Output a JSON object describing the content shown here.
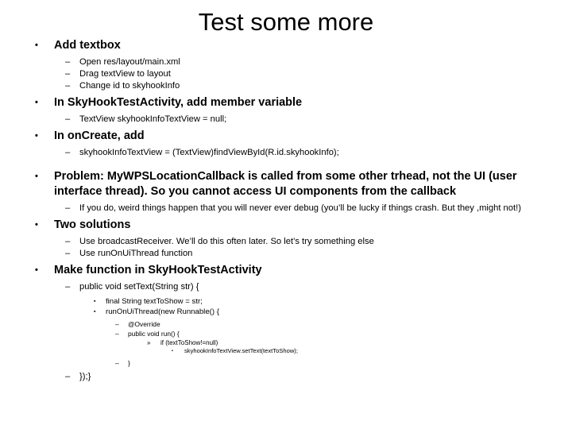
{
  "slide": {
    "title": "Test some more",
    "background_color": "#ffffff",
    "text_color": "#000000",
    "markers": {
      "level1": "•",
      "level2": "–",
      "level3": "▪",
      "level4": "–",
      "level5": "»",
      "level6": "▪"
    },
    "bullets": [
      {
        "level": 1,
        "text": "Add textbox"
      },
      {
        "level": 2,
        "text": "Open res/layout/main.xml"
      },
      {
        "level": 2,
        "text": "Drag textView to layout"
      },
      {
        "level": 2,
        "text": "Change id to skyhookInfo"
      },
      {
        "level": 1,
        "text": "In SkyHookTestActivity, add member variable"
      },
      {
        "level": 2,
        "text": "TextView skyhookInfoTextView = null;"
      },
      {
        "level": 1,
        "text": "In onCreate, add"
      },
      {
        "level": 2,
        "text": "skyhookInfoTextView = (TextView)findViewById(R.id.skyhookInfo);"
      },
      {
        "level": 1,
        "text": "Problem: MyWPSLocationCallback is called from some other trhead, not the UI (user interface thread). So you cannot access UI components from the callback"
      },
      {
        "level": 2,
        "text": "If you do, weird things happen that you will never ever debug (you’ll be lucky if things crash. But they ,might not!)"
      },
      {
        "level": 1,
        "text": "Two solutions"
      },
      {
        "level": 2,
        "text": "Use broadcastReceiver. We’ll do this often later. So let’s try something else"
      },
      {
        "level": 2,
        "text": "Use runOnUiThread function"
      },
      {
        "level": 1,
        "text": "Make function in SkyHookTestActivity"
      },
      {
        "level": 2,
        "text": "public void setText(String str) {"
      },
      {
        "level": 3,
        "text": "final String textToShow = str;"
      },
      {
        "level": 3,
        "text": "runOnUiThread(new Runnable() {"
      },
      {
        "level": 4,
        "text": "@Override"
      },
      {
        "level": 4,
        "text": "public void run() {"
      },
      {
        "level": 5,
        "text": "if (textToShow!=null)"
      },
      {
        "level": 6,
        "text": "skyhookInfoTextView.setText(textToShow);"
      },
      {
        "level": 4,
        "text": "}"
      },
      {
        "level": 2,
        "text": "});}"
      }
    ]
  }
}
